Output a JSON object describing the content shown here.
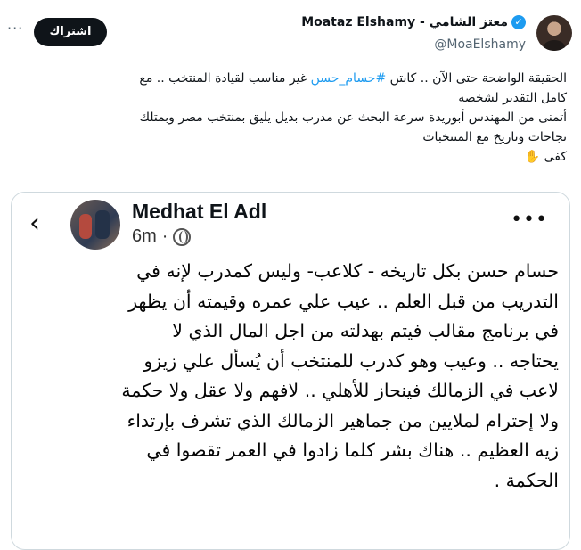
{
  "header": {
    "display_name": "Moataz Elshamy - معتز الشامي",
    "verified_icon": "verified-badge-icon",
    "handle": "@MoaElshamy",
    "subscribe_label": "اشتراك",
    "more_label": "···"
  },
  "tweet": {
    "lines": [
      [
        "الحقيقة الواضحة حتى الآن .. كابتن ",
        "#حسام_حسن",
        " غير مناسب لقيادة المنتخب .. مع"
      ],
      [
        "كامل التقدير لشخصه"
      ],
      [
        "أتمنى من المهندس أبوريدة سرعة البحث عن مدرب بديل يليق بمنتخب مصر وبمتلك"
      ],
      [
        "نجاحات وتاريخ مع المنتخبات"
      ],
      [
        "كفى ",
        "✋"
      ]
    ],
    "accent_color": "#1d9bf0"
  },
  "embedded_post": {
    "back_label": "‹",
    "author": "Medhat El Adl",
    "time": "6m",
    "separator": "·",
    "audience_icon": "globe-icon",
    "more_label": "•••",
    "lines": [
      "حسام حسن بكل تاريخه - كلاعب- وليس كمدرب لإنه  في",
      "التدريب من قبل العلم .. عيب علي عمره وقيمته أن يظهر",
      "في برنامج مقالب فيتم بهدلته من اجل المال الذي لا",
      "يحتاجه .. وعيب وهو كدرب للمنتخب أن يُسأل علي زيزو",
      "لاعب في الزمالك فينحاز للأهلي .. لافهم ولا عقل ولا حكمة",
      "ولا إحترام لملايين من جماهير الزمالك الذي تشرف بإرتداء",
      "زيه العظيم .. هناك بشر كلما زادوا في العمر تقصوا في",
      "الحكمة ."
    ]
  }
}
